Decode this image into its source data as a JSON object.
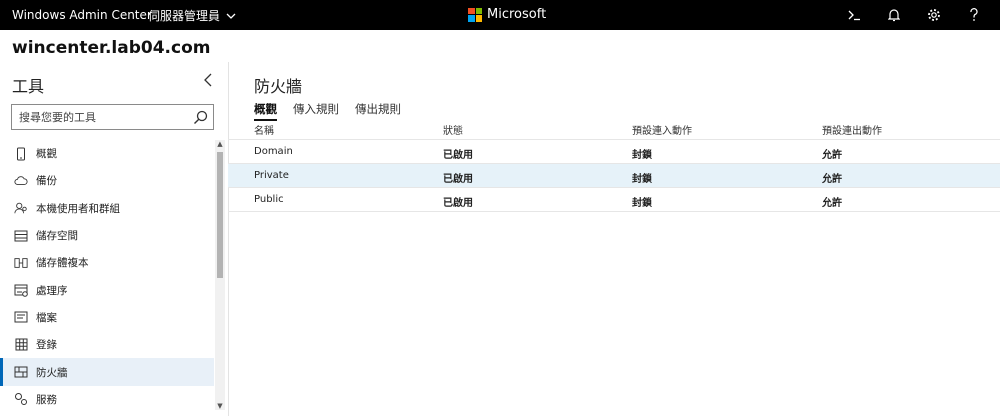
{
  "topbar": {
    "app_title": "Windows Admin Center",
    "context_label": "伺服器管理員",
    "brand": "Microsoft",
    "brand_colors": [
      "#f25022",
      "#7fba00",
      "#00a4ef",
      "#ffb900"
    ],
    "icons": [
      "terminal-icon",
      "bell-icon",
      "gear-icon",
      "help-icon"
    ]
  },
  "server": {
    "name": "wincenter.lab04.com"
  },
  "sidebar": {
    "title": "工具",
    "search_placeholder": "搜尋您要的工具",
    "items": [
      {
        "label": "概觀",
        "icon": "device-icon"
      },
      {
        "label": "備份",
        "icon": "cloud-icon"
      },
      {
        "label": "本機使用者和群組",
        "icon": "users-icon"
      },
      {
        "label": "儲存空間",
        "icon": "storage-icon"
      },
      {
        "label": "儲存體複本",
        "icon": "replica-icon"
      },
      {
        "label": "處理序",
        "icon": "process-icon"
      },
      {
        "label": "檔案",
        "icon": "files-icon"
      },
      {
        "label": "登錄",
        "icon": "registry-icon"
      },
      {
        "label": "防火牆",
        "icon": "firewall-icon",
        "active": true
      },
      {
        "label": "服務",
        "icon": "services-icon"
      }
    ]
  },
  "main": {
    "title": "防火牆",
    "tabs": [
      {
        "label": "概觀",
        "active": true
      },
      {
        "label": "傳入規則"
      },
      {
        "label": "傳出規則"
      }
    ],
    "table": {
      "headers": [
        "名稱",
        "狀態",
        "預設連入動作",
        "預設連出動作"
      ],
      "rows": [
        {
          "name": "Domain",
          "status": "已啟用",
          "inbound": "封鎖",
          "outbound": "允許"
        },
        {
          "name": "Private",
          "status": "已啟用",
          "inbound": "封鎖",
          "outbound": "允許"
        },
        {
          "name": "Public",
          "status": "已啟用",
          "inbound": "封鎖",
          "outbound": "允許"
        }
      ]
    }
  },
  "colors": {
    "accent": "#0067b8",
    "selected_row": "#e6f2f9",
    "topbar_bg": "#000000"
  }
}
